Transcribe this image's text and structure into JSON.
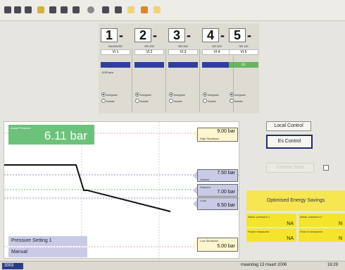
{
  "compressors": [
    {
      "num": "1",
      "model": "SA160VSD",
      "vid": "VI.1",
      "bar": "blue",
      "bar_label": "",
      "rpm": "0,00 rpm"
    },
    {
      "num": "2",
      "model": "GR 200",
      "vid": "VI.2",
      "bar": "blue",
      "bar_label": "",
      "rpm": ""
    },
    {
      "num": "3",
      "model": "GR 200",
      "vid": "VI.3",
      "bar": "blue",
      "bar_label": "",
      "rpm": ""
    },
    {
      "num": "4",
      "model": "GR 200",
      "vid": "VI.4",
      "bar": "blue",
      "bar_label": "",
      "rpm": ""
    },
    {
      "num": "5",
      "model": "SR 110",
      "vid": "VI.5",
      "bar": "green",
      "bar_label": "UL",
      "rpm": ""
    }
  ],
  "radio_labels": {
    "integrate": "Integrate",
    "isolate": "Isolate"
  },
  "controls": {
    "local_control": "Local Control",
    "es_control": "Es Control",
    "central_stop": "Central Stop"
  },
  "graph": {
    "actual_label": "Actual Pressure",
    "actual_value": "6.11 bar",
    "high_shutdown_label": "High Shutdown",
    "high_shutdown_value": "9.00 bar",
    "unload_label": "Unload",
    "unload_value": "7.50 bar",
    "setpoint_label": "Setpoint",
    "setpoint_value": "7.00 bar",
    "load_label": "Load",
    "load_value": "6.50 bar",
    "low_shutdown_label": "Low Shutdown",
    "low_shutdown_value": "5.00 bar",
    "pressure_setting": "Pressure Setting 1",
    "mode": "Manual"
  },
  "energy": {
    "title": "Optimised Energy Savings",
    "cells": [
      {
        "label": "Absol. pressure 1",
        "value": "NA"
      },
      {
        "label": "Absol. pressure 2",
        "value": "N"
      },
      {
        "label": "Power measured",
        "value": "NA"
      },
      {
        "label": "Flow m measured",
        "value": "N"
      }
    ]
  },
  "status": {
    "id": "3003",
    "date": "maandag 13 maart 2006",
    "time": "16:29"
  },
  "colors": {
    "bar_blue": "#2e3fa0",
    "bar_green": "#64b65c",
    "actual_green": "#6cc27a",
    "energy_yellow": "#f4e52c"
  }
}
